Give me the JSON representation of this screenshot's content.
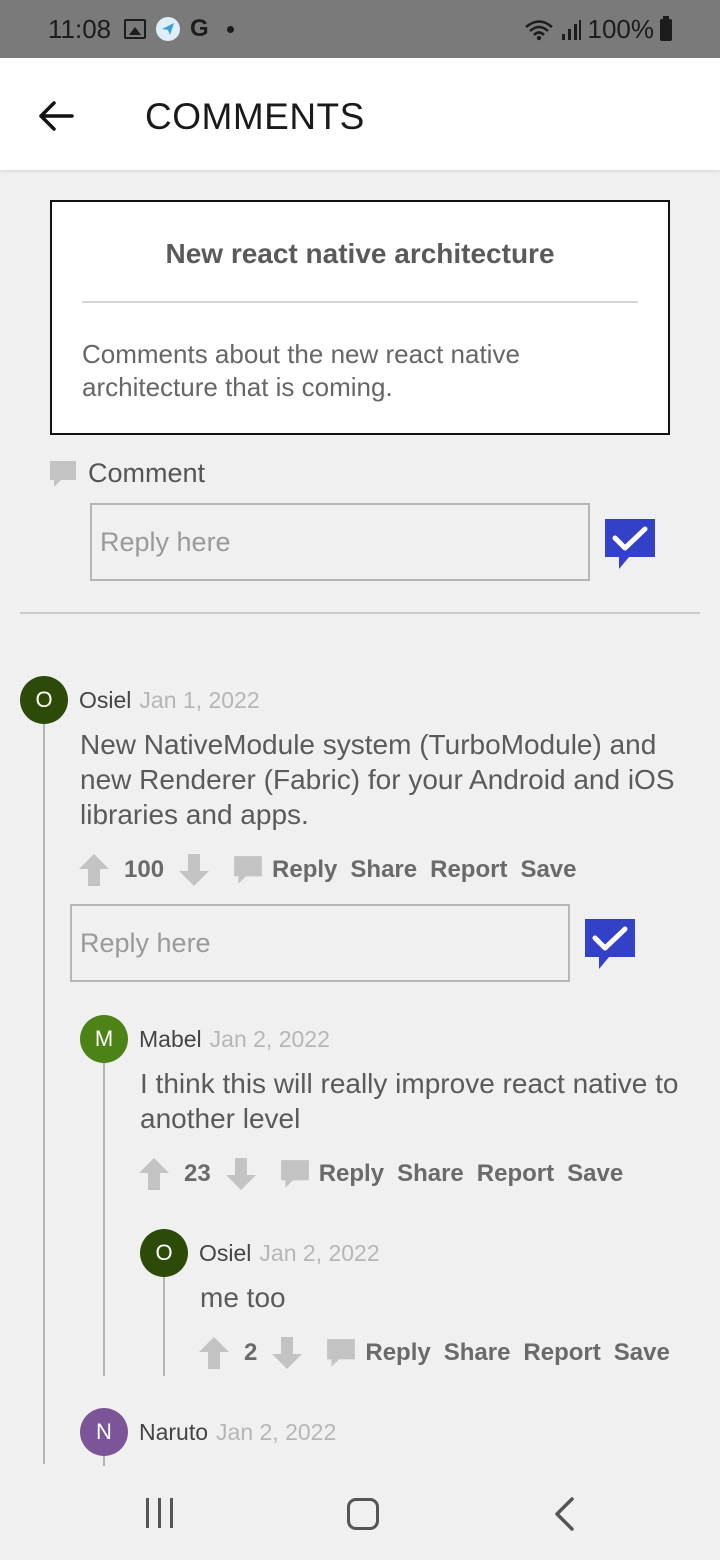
{
  "status_bar": {
    "time": "11:08",
    "g_icon": "G",
    "battery": "100%"
  },
  "app_bar": {
    "title": "COMMENTS"
  },
  "post": {
    "title": "New react native architecture",
    "body_line1": "Comments about the new react native",
    "body_line2": "architecture that is coming."
  },
  "comment_label": "Comment",
  "reply_placeholder": "Reply here",
  "actions": {
    "reply": "Reply",
    "share": "Share",
    "report": "Report",
    "save": "Save"
  },
  "comments": [
    {
      "initial": "O",
      "author": "Osiel",
      "date": "Jan 1, 2022",
      "avatar_color": "#2e4a09",
      "line1": "New NativeModule system (TurboModule) and",
      "line2": "new Renderer (Fabric) for your Android and iOS",
      "line3": "libraries and apps.",
      "votes": "100"
    },
    {
      "initial": "M",
      "author": "Mabel",
      "date": "Jan 2, 2022",
      "avatar_color": "#4d8217",
      "line1": "I think this will really improve react native to",
      "line2": "another level",
      "votes": "23"
    },
    {
      "initial": "O",
      "author": "Osiel",
      "date": "Jan 2, 2022",
      "avatar_color": "#2e4a09",
      "line1": "me too",
      "votes": "2"
    },
    {
      "initial": "N",
      "author": "Naruto",
      "date": "Jan 2, 2022",
      "avatar_color": "#7c5599"
    }
  ],
  "colors": {
    "accent": "#3340c8",
    "icon_gray": "#c3c3c3"
  }
}
